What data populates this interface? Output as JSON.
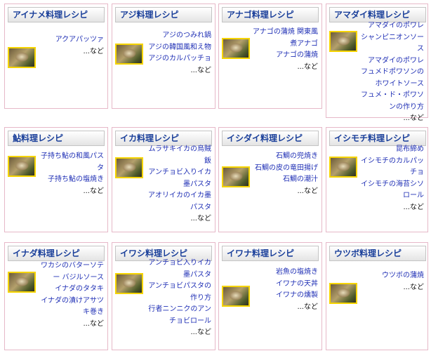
{
  "cards": [
    {
      "title": "アイナメ料理レシピ",
      "thumb": "greenling-dish-photo",
      "links": [
        "アクアパッツァ"
      ],
      "more": "...など"
    },
    {
      "title": "アジ料理レシピ",
      "thumb": "horse-mackerel-dish-photo",
      "links": [
        "アジのつみれ鍋",
        "アジの韓国風和え物",
        "アジのカルパッチョ"
      ],
      "more": "...など"
    },
    {
      "title": "アナゴ料理レシピ",
      "thumb": "conger-eel-dish-photo",
      "links": [
        "アナゴの蒲焼 関東風",
        "煮アナゴ",
        "アナゴの蒲焼"
      ],
      "more": "...など"
    },
    {
      "title": "アマダイ料理レシピ",
      "thumb": "tilefish-dish-photo",
      "links": [
        "アマダイのポワレ シャンピニオンソース",
        "アマダイのポワレ フュメドポワソンのホワイトソース",
        "フュメ・ド・ポワソンの作り方"
      ],
      "more": "...など"
    },
    {
      "title": "鮎料理レシピ",
      "thumb": "ayu-dish-photo",
      "links": [
        "子持ち鮎の和風パスタ",
        "子持ち鮎の塩焼き"
      ],
      "more": "...など"
    },
    {
      "title": "イカ料理レシピ",
      "thumb": "squid-dish-photo",
      "links": [
        "ムラサキイカの烏賊飯",
        "アンチョビ入りイカ墨パスタ",
        "アオリイカのイカ墨パスタ"
      ],
      "more": "...など"
    },
    {
      "title": "イシダイ料理レシピ",
      "thumb": "striped-beakfish-dish-photo",
      "links": [
        "石鯛の兜焼き",
        "石鯛の皮の竜田揚げ",
        "石鯛の潮汁"
      ],
      "more": "...など"
    },
    {
      "title": "イシモチ料理レシピ",
      "thumb": "croaker-dish-photo",
      "links": [
        "昆布締め",
        "イシモチのカルパッチョ",
        "イシモチの海苔シソロール"
      ],
      "more": "...など"
    },
    {
      "title": "イナダ料理レシピ",
      "thumb": "yellowtail-dish-photo",
      "links": [
        "ワカシのバターソテー バジルソース",
        "イナダのタタキ",
        "イナダの漬けアサツキ巻き"
      ],
      "more": "...など"
    },
    {
      "title": "イワシ料理レシピ",
      "thumb": "sardine-dish-photo",
      "links": [
        "アンチョビ入りイカ墨パスタ",
        "アンチョビパスタの作り方",
        "行者ニンニクのアンチョビロール"
      ],
      "more": "...など"
    },
    {
      "title": "イワナ料理レシピ",
      "thumb": "char-dish-photo",
      "links": [
        "岩魚の塩焼き",
        "イワナの天丼",
        "イワナの燻製"
      ],
      "more": "...など"
    },
    {
      "title": "ウツボ料理レシピ",
      "thumb": "moray-eel-dish-photo",
      "links": [
        "ウツボの蒲焼"
      ],
      "more": "...など"
    }
  ]
}
